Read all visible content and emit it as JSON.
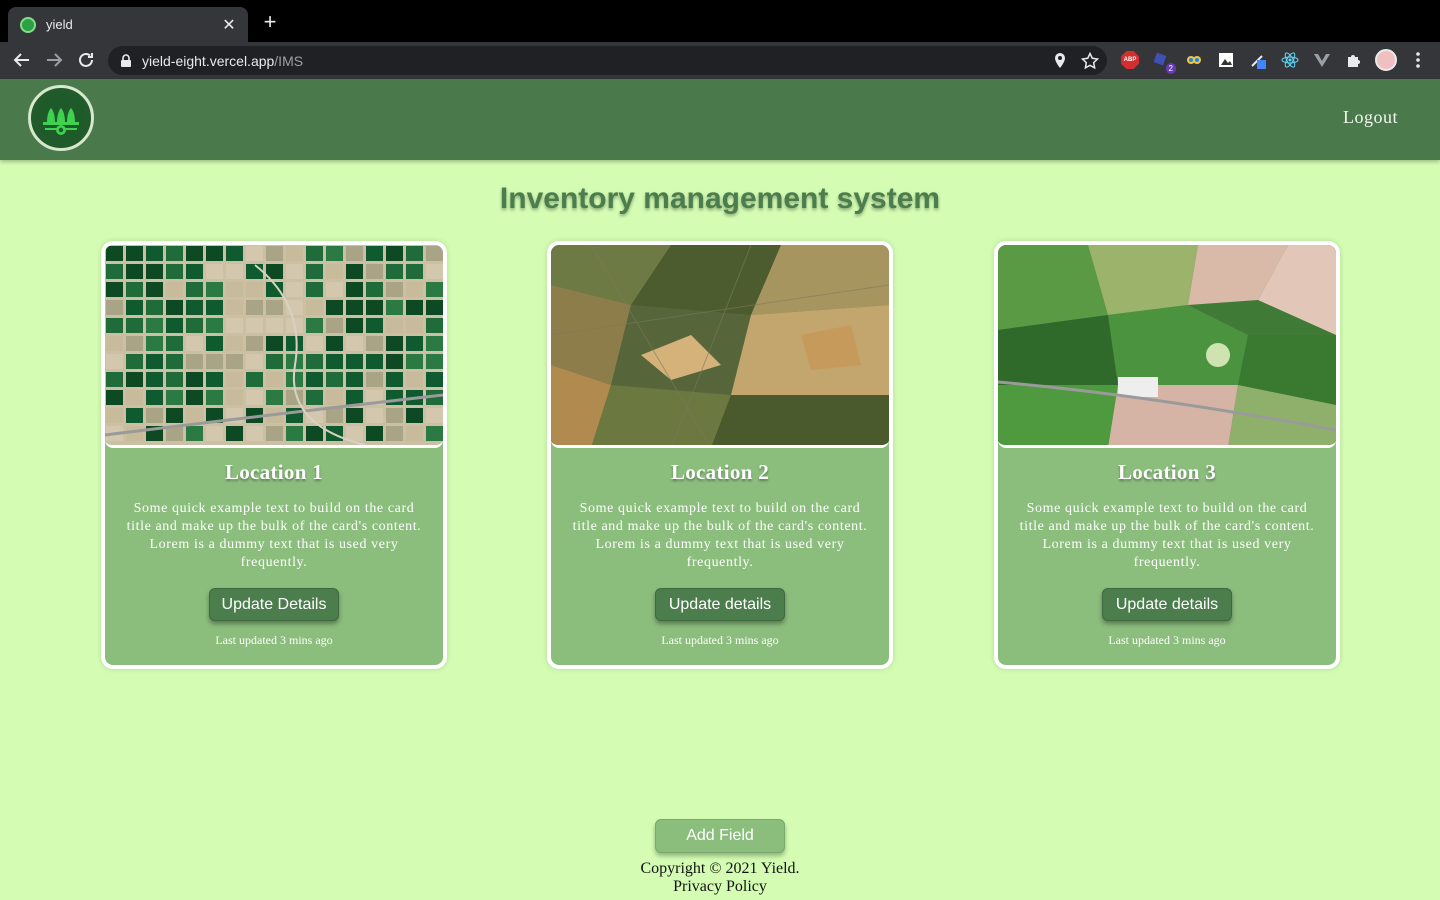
{
  "browser": {
    "tab_title": "yield",
    "url_host": "yield-eight.vercel.app",
    "url_path": "/IMS",
    "extensions": [
      {
        "icon": "adblock-icon",
        "label": "ABP"
      },
      {
        "icon": "shapes-extension-icon",
        "badge": "2"
      },
      {
        "icon": "owl-extension-icon"
      },
      {
        "icon": "image-extension-icon"
      },
      {
        "icon": "pen-extension-icon"
      },
      {
        "icon": "react-devtools-icon"
      },
      {
        "icon": "vue-devtools-icon"
      },
      {
        "icon": "puzzle-icon"
      },
      {
        "icon": "profile-avatar"
      },
      {
        "icon": "kebab-menu-icon"
      }
    ]
  },
  "header": {
    "logout_label": "Logout"
  },
  "main": {
    "title": "Inventory management system",
    "cards": [
      {
        "title": "Location 1",
        "text": "Some quick example text to build on the card title and make up the bulk of the card's content. Lorem is a dummy text that is used very frequently.",
        "button": "Update Details",
        "updated": "Last updated 3 mins ago"
      },
      {
        "title": "Location 2",
        "text": "Some quick example text to build on the card title and make up the bulk of the card's content. Lorem is a dummy text that is used very frequently.",
        "button": "Update details",
        "updated": "Last updated 3 mins ago"
      },
      {
        "title": "Location 3",
        "text": "Some quick example text to build on the card title and make up the bulk of the card's content. Lorem is a dummy text that is used very frequently.",
        "button": "Update details",
        "updated": "Last updated 3 mins ago"
      }
    ]
  },
  "footer": {
    "add_field_label": "Add Field",
    "copyright": "Copyright © 2021 Yield.",
    "privacy": "Privacy Policy"
  },
  "colors": {
    "page_bg": "#d4fdb3",
    "header_bg": "#4a7a4b",
    "card_bg": "#8bbd7d",
    "button_bg": "#4c7d4d"
  }
}
